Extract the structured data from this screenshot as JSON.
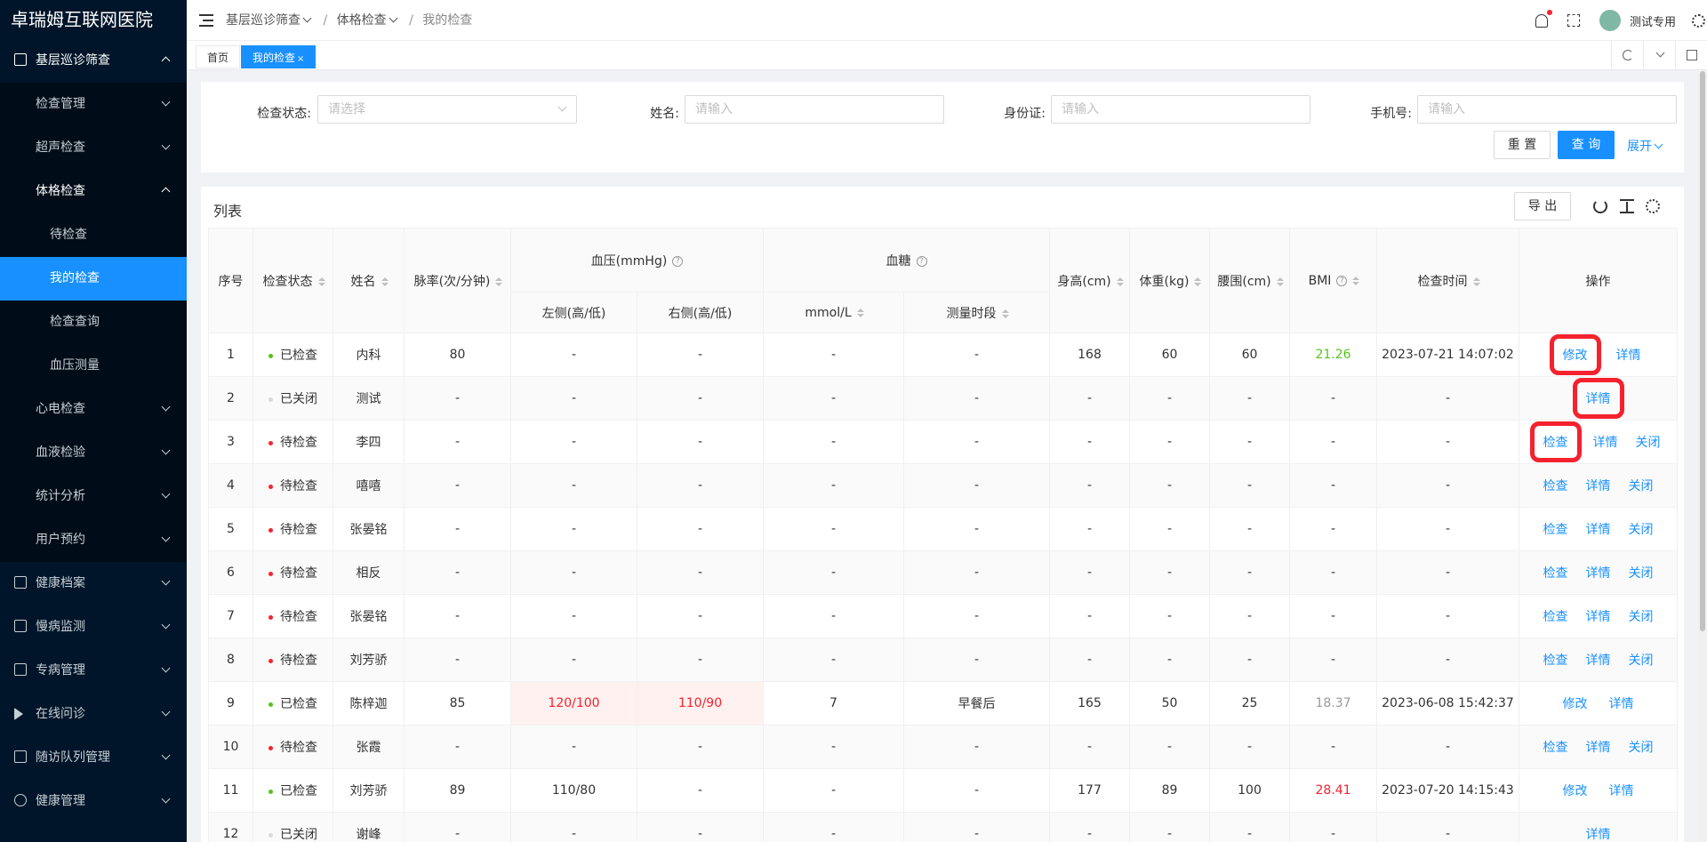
{
  "app": {
    "title": "卓瑞姆互联网医院"
  },
  "sidebar": {
    "items": [
      {
        "label": "基层巡诊筛查",
        "level": 1,
        "state": "open",
        "icon": "chart-icon"
      },
      {
        "label": "检查管理",
        "level": 2,
        "state": "collapsed"
      },
      {
        "label": "超声检查",
        "level": 2,
        "state": "collapsed"
      },
      {
        "label": "体格检查",
        "level": 2,
        "state": "open"
      },
      {
        "label": "待检查",
        "level": 3,
        "state": ""
      },
      {
        "label": "我的检查",
        "level": 3,
        "state": "active"
      },
      {
        "label": "检查查询",
        "level": 3,
        "state": ""
      },
      {
        "label": "血压测量",
        "level": 3,
        "state": ""
      },
      {
        "label": "心电检查",
        "level": 2,
        "state": "collapsed"
      },
      {
        "label": "血液检验",
        "level": 2,
        "state": "collapsed"
      },
      {
        "label": "统计分析",
        "level": 2,
        "state": "collapsed"
      },
      {
        "label": "用户预约",
        "level": 2,
        "state": "collapsed"
      },
      {
        "label": "健康档案",
        "level": 1,
        "state": "collapsed",
        "icon": "record-icon"
      },
      {
        "label": "慢病监测",
        "level": 1,
        "state": "collapsed",
        "icon": "monitor-icon"
      },
      {
        "label": "专病管理",
        "level": 1,
        "state": "collapsed",
        "icon": "disease-icon"
      },
      {
        "label": "在线问诊",
        "level": 1,
        "state": "collapsed",
        "icon": "send-icon"
      },
      {
        "label": "随访队列管理",
        "level": 1,
        "state": "collapsed",
        "icon": "queue-icon"
      },
      {
        "label": "健康管理",
        "level": 1,
        "state": "collapsed",
        "icon": "shield-icon"
      }
    ]
  },
  "header": {
    "breadcrumb": [
      "基层巡诊筛查",
      "体格检查",
      "我的检查"
    ],
    "username": "测试专用"
  },
  "tabs": [
    {
      "label": "首页",
      "active": false
    },
    {
      "label": "我的检查",
      "active": true,
      "close": "×"
    }
  ],
  "search": {
    "status_label": "检查状态:",
    "status_placeholder": "请选择",
    "name_label": "姓名:",
    "name_placeholder": "请输入",
    "id_label": "身份证:",
    "id_placeholder": "请输入",
    "phone_label": "手机号:",
    "phone_placeholder": "请输入",
    "reset_label": "重 置",
    "query_label": "查 询",
    "expand_label": "展开"
  },
  "table": {
    "title": "列表",
    "export_label": "导 出",
    "headers": {
      "index": "序号",
      "status": "检查状态",
      "name": "姓名",
      "pulse": "脉率(次/分钟)",
      "bp": "血压(mmHg)",
      "bp_left": "左侧(高/低)",
      "bp_right": "右侧(高/低)",
      "glucose": "血糖",
      "glucose_unit": "mmol/L",
      "glucose_period": "测量时段",
      "height": "身高(cm)",
      "weight": "体重(kg)",
      "waist": "腰围(cm)",
      "bmi": "BMI",
      "time": "检查时间",
      "ops": "操作"
    },
    "status_colors": {
      "已检查": "#52c41a",
      "已关闭": "#d9d9d9",
      "待检查": "#f5222d"
    },
    "rows": [
      {
        "idx": "1",
        "status": "已检查",
        "name": "内科",
        "pulse": "80",
        "bpl": "-",
        "bpr": "-",
        "glu": "-",
        "period": "-",
        "height": "168",
        "weight": "60",
        "waist": "60",
        "bmi": "21.26",
        "bmi_color": "green",
        "time": "2023-07-21 14:07:02",
        "ops": [
          "修改",
          "详情"
        ],
        "hl": [
          0
        ]
      },
      {
        "idx": "2",
        "status": "已关闭",
        "name": "测试",
        "pulse": "-",
        "bpl": "-",
        "bpr": "-",
        "glu": "-",
        "period": "-",
        "height": "-",
        "weight": "-",
        "waist": "-",
        "bmi": "-",
        "time": "-",
        "ops": [
          "详情"
        ],
        "hl": [
          0
        ]
      },
      {
        "idx": "3",
        "status": "待检查",
        "name": "李四",
        "pulse": "-",
        "bpl": "-",
        "bpr": "-",
        "glu": "-",
        "period": "-",
        "height": "-",
        "weight": "-",
        "waist": "-",
        "bmi": "-",
        "time": "-",
        "ops": [
          "检查",
          "详情",
          "关闭"
        ],
        "hl": [
          0
        ]
      },
      {
        "idx": "4",
        "status": "待检查",
        "name": "嘻嘻",
        "pulse": "-",
        "bpl": "-",
        "bpr": "-",
        "glu": "-",
        "period": "-",
        "height": "-",
        "weight": "-",
        "waist": "-",
        "bmi": "-",
        "time": "-",
        "ops": [
          "检查",
          "详情",
          "关闭"
        ]
      },
      {
        "idx": "5",
        "status": "待检查",
        "name": "张晏铭",
        "pulse": "-",
        "bpl": "-",
        "bpr": "-",
        "glu": "-",
        "period": "-",
        "height": "-",
        "weight": "-",
        "waist": "-",
        "bmi": "-",
        "time": "-",
        "ops": [
          "检查",
          "详情",
          "关闭"
        ]
      },
      {
        "idx": "6",
        "status": "待检查",
        "name": "相反",
        "pulse": "-",
        "bpl": "-",
        "bpr": "-",
        "glu": "-",
        "period": "-",
        "height": "-",
        "weight": "-",
        "waist": "-",
        "bmi": "-",
        "time": "-",
        "ops": [
          "检查",
          "详情",
          "关闭"
        ]
      },
      {
        "idx": "7",
        "status": "待检查",
        "name": "张晏铭",
        "pulse": "-",
        "bpl": "-",
        "bpr": "-",
        "glu": "-",
        "period": "-",
        "height": "-",
        "weight": "-",
        "waist": "-",
        "bmi": "-",
        "time": "-",
        "ops": [
          "检查",
          "详情",
          "关闭"
        ]
      },
      {
        "idx": "8",
        "status": "待检查",
        "name": "刘芳骄",
        "pulse": "-",
        "bpl": "-",
        "bpr": "-",
        "glu": "-",
        "period": "-",
        "height": "-",
        "weight": "-",
        "waist": "-",
        "bmi": "-",
        "time": "-",
        "ops": [
          "检查",
          "详情",
          "关闭"
        ]
      },
      {
        "idx": "9",
        "status": "已检查",
        "name": "陈梓迦",
        "pulse": "85",
        "bpl": "120/100",
        "bpr": "110/90",
        "bp_alert": true,
        "glu": "7",
        "period": "早餐后",
        "height": "165",
        "weight": "50",
        "waist": "25",
        "bmi": "18.37",
        "bmi_color": "gray",
        "time": "2023-06-08 15:42:37",
        "ops": [
          "修改",
          "详情"
        ]
      },
      {
        "idx": "10",
        "status": "待检查",
        "name": "张霞",
        "pulse": "-",
        "bpl": "-",
        "bpr": "-",
        "glu": "-",
        "period": "-",
        "height": "-",
        "weight": "-",
        "waist": "-",
        "bmi": "-",
        "time": "-",
        "ops": [
          "检查",
          "详情",
          "关闭"
        ]
      },
      {
        "idx": "11",
        "status": "已检查",
        "name": "刘芳骄",
        "pulse": "89",
        "bpl": "110/80",
        "bpr": "-",
        "glu": "-",
        "period": "-",
        "height": "177",
        "weight": "89",
        "waist": "100",
        "bmi": "28.41",
        "bmi_color": "red",
        "time": "2023-07-20 14:15:43",
        "ops": [
          "修改",
          "详情"
        ]
      },
      {
        "idx": "12",
        "status": "已关闭",
        "name": "谢峰",
        "pulse": "-",
        "bpl": "-",
        "bpr": "-",
        "glu": "-",
        "period": "-",
        "height": "-",
        "weight": "-",
        "waist": "-",
        "bmi": "-",
        "time": "-",
        "ops": [
          "详情"
        ]
      }
    ]
  }
}
